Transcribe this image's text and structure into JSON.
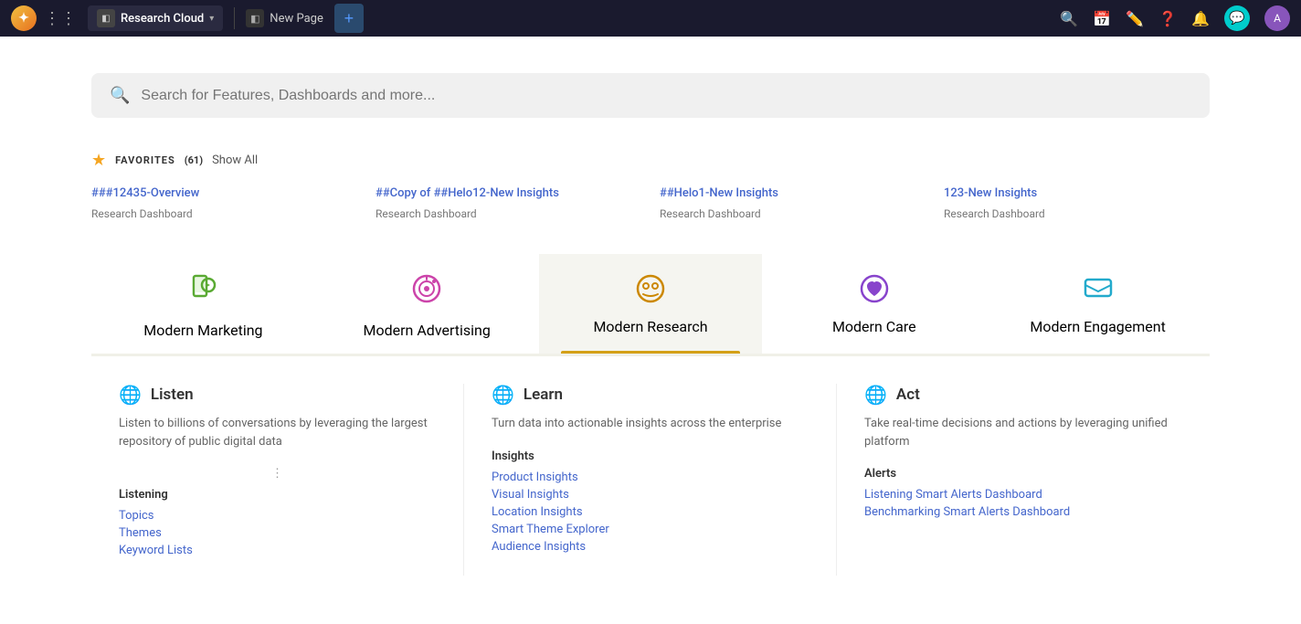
{
  "topnav": {
    "brand": "Research Cloud",
    "new_page": "New Page",
    "add_tab_label": "+",
    "icons": [
      "search",
      "calendar",
      "edit",
      "help",
      "bell",
      "chat",
      "avatar"
    ]
  },
  "search": {
    "placeholder": "Search for Features, Dashboards and more..."
  },
  "favorites": {
    "title": "FAVORITES",
    "count": "(61)",
    "show_all": "Show All",
    "items": [
      {
        "link": "###12435-Overview",
        "type": "Research Dashboard"
      },
      {
        "link": "##Copy of ##Helo12-New Insights",
        "type": "Research Dashboard"
      },
      {
        "link": "##Helo1-New Insights",
        "type": "Research Dashboard"
      },
      {
        "link": "123-New Insights",
        "type": "Research Dashboard"
      }
    ]
  },
  "tabs": [
    {
      "id": "modern-marketing",
      "label": "Modern Marketing",
      "icon": "📱",
      "active": false
    },
    {
      "id": "modern-advertising",
      "label": "Modern Advertising",
      "icon": "🎯",
      "active": false
    },
    {
      "id": "modern-research",
      "label": "Modern Research",
      "icon": "👥",
      "active": true
    },
    {
      "id": "modern-care",
      "label": "Modern Care",
      "icon": "💜",
      "active": false
    },
    {
      "id": "modern-engagement",
      "label": "Modern Engagement",
      "icon": "💬",
      "active": false
    }
  ],
  "content": {
    "listen": {
      "title": "Listen",
      "icon": "🌐",
      "description": "Listen to billions of conversations by leveraging the largest repository of public digital data",
      "section_label": "Listening",
      "links": [
        "Topics",
        "Themes",
        "Keyword Lists"
      ]
    },
    "learn": {
      "title": "Learn",
      "icon": "🌐",
      "description": "Turn data into actionable insights across the enterprise",
      "section_label": "Insights",
      "links": [
        "Product Insights",
        "Visual Insights",
        "Location Insights",
        "Smart Theme Explorer",
        "Audience Insights"
      ]
    },
    "act": {
      "title": "Act",
      "icon": "🌐",
      "description": "Take real-time decisions and actions by leveraging unified platform",
      "section_label": "Alerts",
      "links": [
        "Listening Smart Alerts Dashboard",
        "Benchmarking Smart Alerts Dashboard"
      ]
    }
  }
}
